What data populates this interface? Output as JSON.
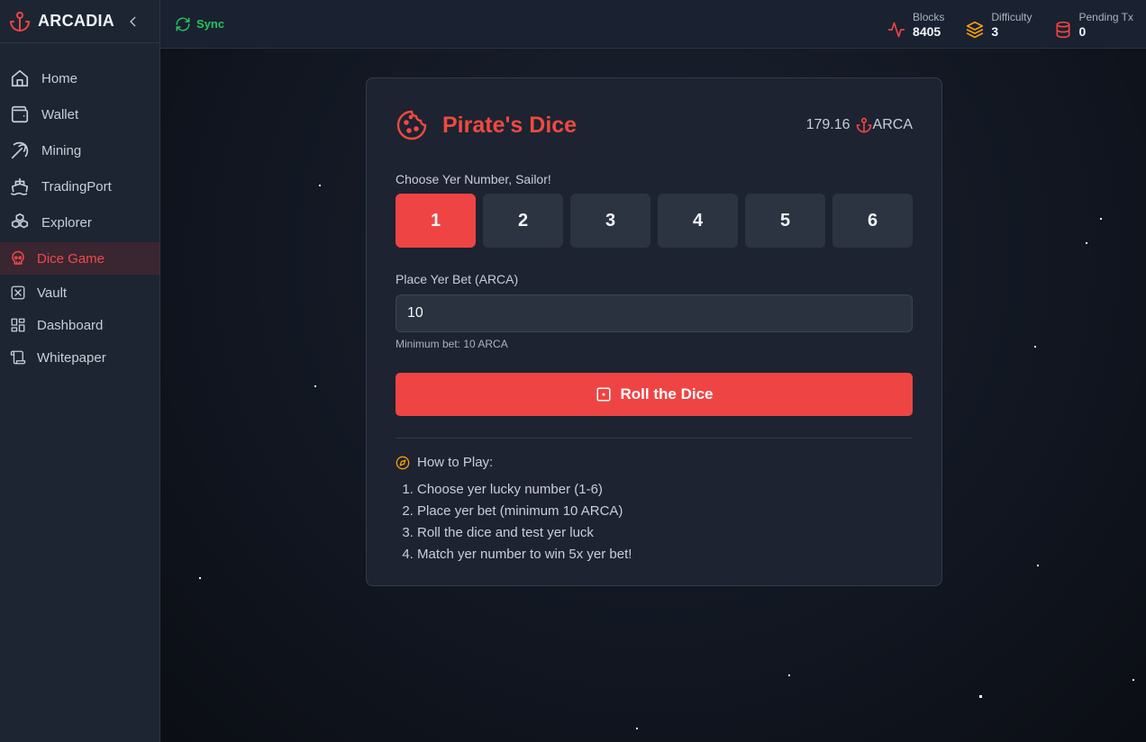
{
  "brand": {
    "name": "ARCADIA"
  },
  "topbar": {
    "sync_label": "Sync",
    "stats": [
      {
        "label": "Blocks",
        "value": "8405",
        "icon": "activity-icon",
        "color": "#ef4444"
      },
      {
        "label": "Difficulty",
        "value": "3",
        "icon": "layers-icon",
        "color": "#f59e0b"
      },
      {
        "label": "Pending Tx",
        "value": "0",
        "icon": "database-icon",
        "color": "#ef4444"
      }
    ]
  },
  "sidebar": {
    "items": [
      {
        "label": "Home",
        "icon": "home-icon"
      },
      {
        "label": "Wallet",
        "icon": "wallet-icon"
      },
      {
        "label": "Mining",
        "icon": "pickaxe-icon"
      },
      {
        "label": "TradingPort",
        "icon": "ship-icon"
      },
      {
        "label": "Explorer",
        "icon": "boxes-icon"
      },
      {
        "label": "Dice Game",
        "icon": "skull-icon",
        "active": true
      },
      {
        "label": "Vault",
        "icon": "vault-icon"
      },
      {
        "label": "Dashboard",
        "icon": "dashboard-icon"
      },
      {
        "label": "Whitepaper",
        "icon": "scroll-icon"
      }
    ]
  },
  "game": {
    "title": "Pirate's Dice",
    "balance": "179.16",
    "currency": "ARCA",
    "choose_label": "Choose Yer Number, Sailor!",
    "numbers": [
      "1",
      "2",
      "3",
      "4",
      "5",
      "6"
    ],
    "selected_number": "1",
    "bet_label": "Place Yer Bet (ARCA)",
    "bet_value": "10",
    "min_bet": "Minimum bet: 10 ARCA",
    "roll_label": "Roll the Dice",
    "howto_title": "How to Play:",
    "steps": [
      "Choose yer lucky number (1-6)",
      "Place yer bet (minimum 10 ARCA)",
      "Roll the dice and test yer luck",
      "Match yer number to win 5x yer bet!"
    ]
  },
  "colors": {
    "accent": "#ef4444",
    "sync": "#22c55e",
    "sidebar_bg": "#1d2532",
    "card_bg": "#1d2331"
  }
}
